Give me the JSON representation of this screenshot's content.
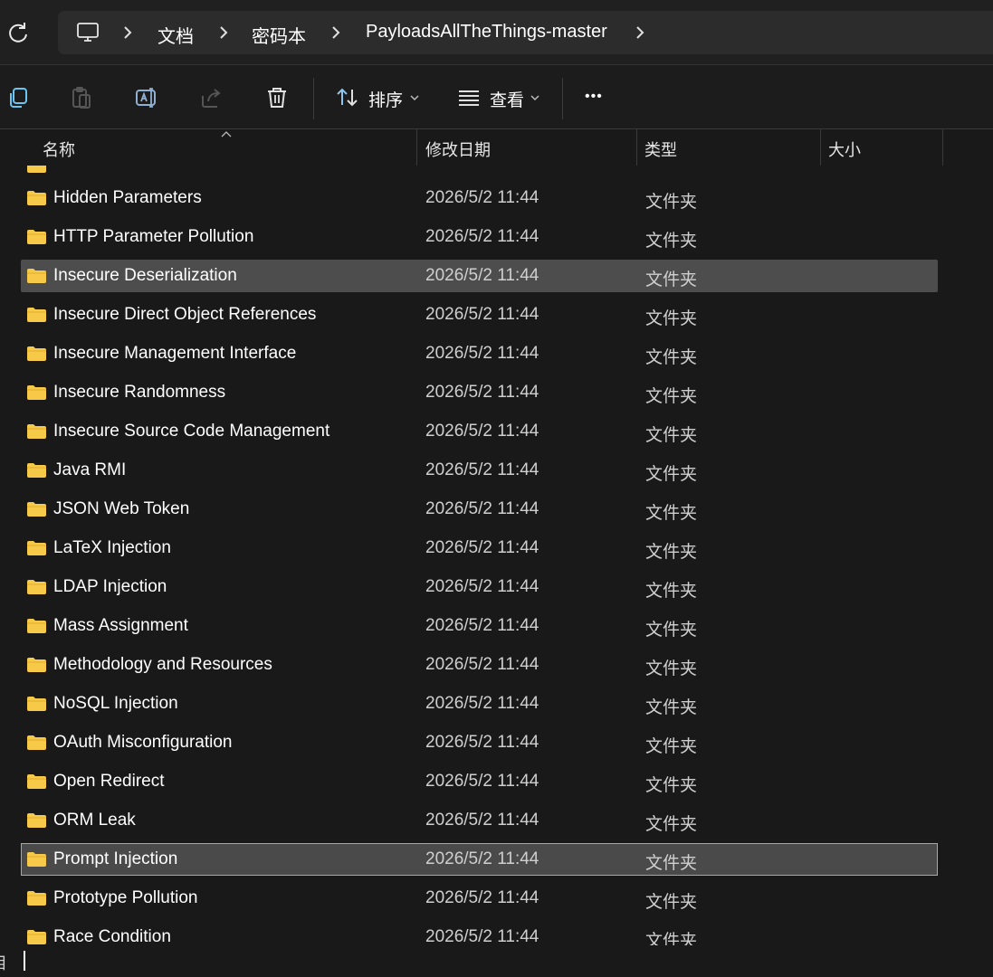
{
  "breadcrumb": {
    "items": [
      "文档",
      "密码本",
      "PayloadsAllTheThings-master"
    ]
  },
  "toolbar": {
    "sort_label": "排序",
    "view_label": "查看",
    "more_label": "•••"
  },
  "columns": {
    "name": "名称",
    "date": "修改日期",
    "type": "类型",
    "size": "大小"
  },
  "files": [
    {
      "name": "Hidden Parameters",
      "date": "2026/5/2 11:44",
      "type": "文件夹"
    },
    {
      "name": "HTTP Parameter Pollution",
      "date": "2026/5/2 11:44",
      "type": "文件夹"
    },
    {
      "name": "Insecure Deserialization",
      "date": "2026/5/2 11:44",
      "type": "文件夹"
    },
    {
      "name": "Insecure Direct Object References",
      "date": "2026/5/2 11:44",
      "type": "文件夹"
    },
    {
      "name": "Insecure Management Interface",
      "date": "2026/5/2 11:44",
      "type": "文件夹"
    },
    {
      "name": "Insecure Randomness",
      "date": "2026/5/2 11:44",
      "type": "文件夹"
    },
    {
      "name": "Insecure Source Code Management",
      "date": "2026/5/2 11:44",
      "type": "文件夹"
    },
    {
      "name": "Java RMI",
      "date": "2026/5/2 11:44",
      "type": "文件夹"
    },
    {
      "name": "JSON Web Token",
      "date": "2026/5/2 11:44",
      "type": "文件夹"
    },
    {
      "name": "LaTeX Injection",
      "date": "2026/5/2 11:44",
      "type": "文件夹"
    },
    {
      "name": "LDAP Injection",
      "date": "2026/5/2 11:44",
      "type": "文件夹"
    },
    {
      "name": "Mass Assignment",
      "date": "2026/5/2 11:44",
      "type": "文件夹"
    },
    {
      "name": "Methodology and Resources",
      "date": "2026/5/2 11:44",
      "type": "文件夹"
    },
    {
      "name": "NoSQL Injection",
      "date": "2026/5/2 11:44",
      "type": "文件夹"
    },
    {
      "name": "OAuth Misconfiguration",
      "date": "2026/5/2 11:44",
      "type": "文件夹"
    },
    {
      "name": "Open Redirect",
      "date": "2026/5/2 11:44",
      "type": "文件夹"
    },
    {
      "name": "ORM Leak",
      "date": "2026/5/2 11:44",
      "type": "文件夹"
    },
    {
      "name": "Prompt Injection",
      "date": "2026/5/2 11:44",
      "type": "文件夹"
    },
    {
      "name": "Prototype Pollution",
      "date": "2026/5/2 11:44",
      "type": "文件夹"
    },
    {
      "name": "Race Condition",
      "date": "2026/5/2 11:44",
      "type": "文件夹"
    }
  ],
  "selection": {
    "hover_item": "Insecure Deserialization",
    "focused_item": "Prompt Injection"
  },
  "status": {
    "text": "目"
  },
  "colors": {
    "folder": "#f7c948",
    "background": "#191919",
    "selected_row": "#4d4d4d"
  }
}
